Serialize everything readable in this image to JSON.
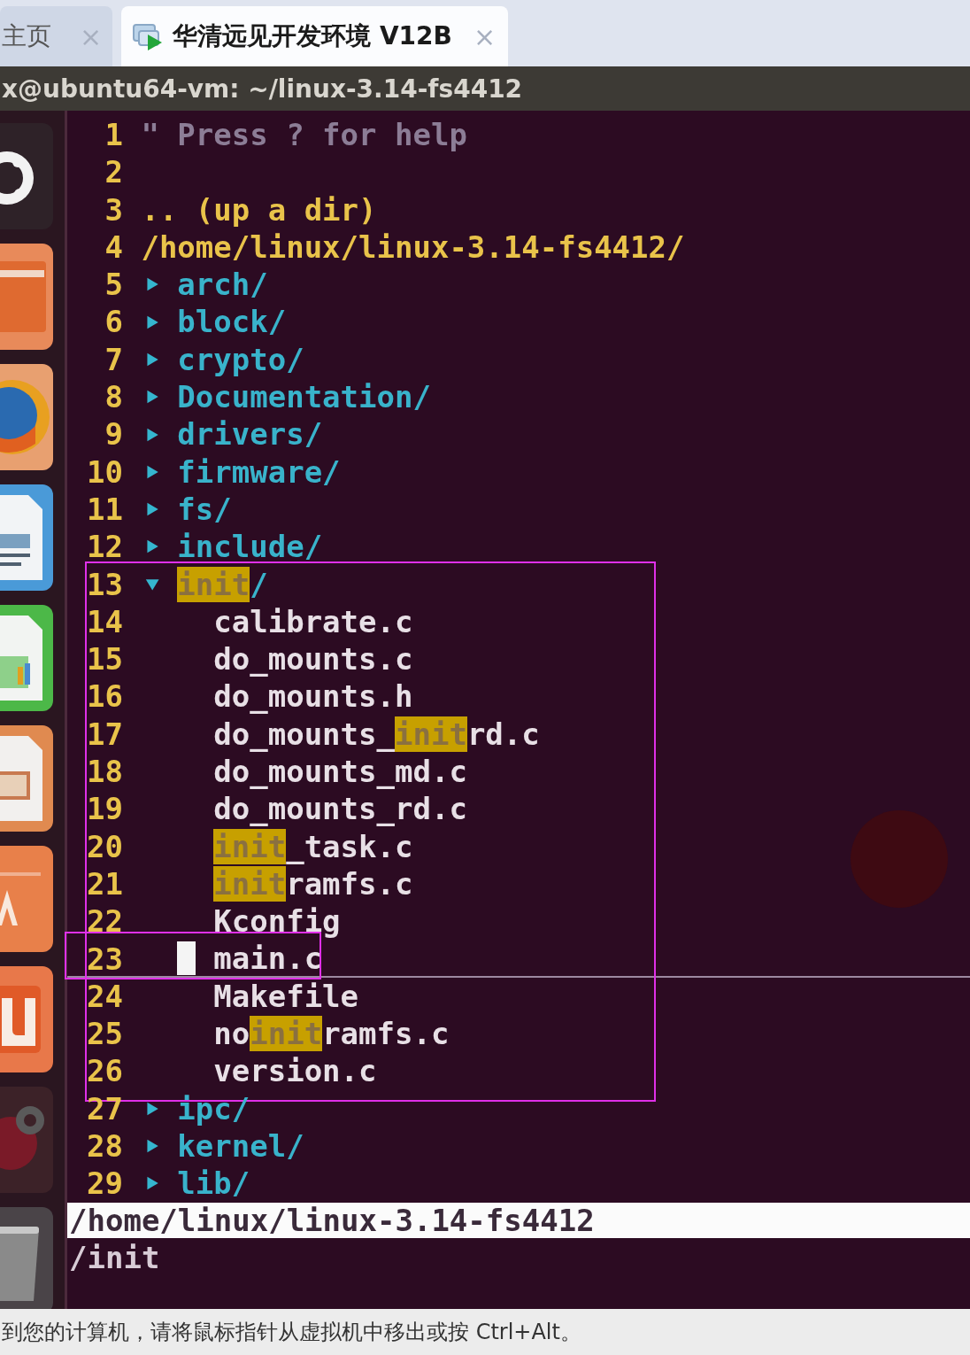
{
  "tabs": [
    {
      "label": "主页",
      "selected": false,
      "close": "×"
    },
    {
      "label": "华清远见开发环境 V12B",
      "selected": true,
      "close": "×"
    }
  ],
  "window": {
    "title": "x@ubuntu64-vm: ~/linux-3.14-fs4412"
  },
  "tree": [
    {
      "number": "1",
      "kind": "comment",
      "text": "\" Press ? for help"
    },
    {
      "number": "2",
      "kind": "blank"
    },
    {
      "number": "3",
      "kind": "updir",
      "text": ".. (up a dir)"
    },
    {
      "number": "4",
      "kind": "root",
      "text": "/home/linux/linux-3.14-fs4412/"
    },
    {
      "number": "5",
      "kind": "dir",
      "expanded": false,
      "boxed": false,
      "text": "arch/"
    },
    {
      "number": "6",
      "kind": "dir",
      "expanded": false,
      "boxed": false,
      "text": "block/"
    },
    {
      "number": "7",
      "kind": "dir",
      "expanded": false,
      "boxed": false,
      "text": "crypto/"
    },
    {
      "number": "8",
      "kind": "dir",
      "expanded": false,
      "boxed": false,
      "text": "Documentation/"
    },
    {
      "number": "9",
      "kind": "dir",
      "expanded": false,
      "boxed": false,
      "text": "drivers/"
    },
    {
      "number": "10",
      "kind": "dir",
      "expanded": false,
      "boxed": false,
      "text": "firmware/"
    },
    {
      "number": "11",
      "kind": "dir",
      "expanded": false,
      "boxed": false,
      "text": "fs/"
    },
    {
      "number": "12",
      "kind": "dir",
      "expanded": false,
      "boxed": false,
      "text": "include/"
    },
    {
      "number": "13",
      "kind": "dir",
      "expanded": true,
      "boxed": true,
      "parts": [
        {
          "text": "init",
          "match": true
        },
        {
          "text": "/",
          "match": false
        }
      ],
      "children": [
        {
          "number": "14",
          "kind": "file",
          "cursor": false,
          "marked": false,
          "text": "calibrate.c"
        },
        {
          "number": "15",
          "kind": "file",
          "cursor": false,
          "marked": false,
          "text": "do_mounts.c"
        },
        {
          "number": "16",
          "kind": "file",
          "cursor": false,
          "marked": false,
          "text": "do_mounts.h"
        },
        {
          "number": "17",
          "kind": "file",
          "cursor": false,
          "marked": false,
          "parts": [
            {
              "text": "do_mounts_",
              "match": false
            },
            {
              "text": "init",
              "match": true
            },
            {
              "text": "rd.c",
              "match": false
            }
          ]
        },
        {
          "number": "18",
          "kind": "file",
          "cursor": false,
          "marked": false,
          "text": "do_mounts_md.c"
        },
        {
          "number": "19",
          "kind": "file",
          "cursor": false,
          "marked": false,
          "text": "do_mounts_rd.c"
        },
        {
          "number": "20",
          "kind": "file",
          "cursor": false,
          "marked": false,
          "parts": [
            {
              "text": "init",
              "match": true
            },
            {
              "text": "_task.c",
              "match": false
            }
          ]
        },
        {
          "number": "21",
          "kind": "file",
          "cursor": false,
          "marked": false,
          "parts": [
            {
              "text": "init",
              "match": true
            },
            {
              "text": "ramfs.c",
              "match": false
            }
          ]
        },
        {
          "number": "22",
          "kind": "file",
          "cursor": false,
          "marked": false,
          "text": "Kconfig"
        },
        {
          "number": "23",
          "kind": "file",
          "cursor": true,
          "marked": true,
          "text": "main.c"
        },
        {
          "number": "24",
          "kind": "file",
          "cursor": false,
          "marked": false,
          "text": "Makefile"
        },
        {
          "number": "25",
          "kind": "file",
          "cursor": false,
          "marked": false,
          "parts": [
            {
              "text": "no",
              "match": false
            },
            {
              "text": "init",
              "match": true
            },
            {
              "text": "ramfs.c",
              "match": false
            }
          ]
        },
        {
          "number": "26",
          "kind": "file",
          "cursor": false,
          "marked": false,
          "text": "version.c"
        }
      ]
    },
    {
      "number": "27",
      "kind": "dir",
      "expanded": false,
      "boxed": false,
      "text": "ipc/"
    },
    {
      "number": "28",
      "kind": "dir",
      "expanded": false,
      "boxed": false,
      "text": "kernel/"
    },
    {
      "number": "29",
      "kind": "dir",
      "expanded": false,
      "boxed": false,
      "text": "lib/"
    }
  ],
  "status_line": {
    "path": "/home/linux/linux-3.14-fs4412",
    "current": "/init"
  },
  "status_bar": {
    "text": "到您的计算机，请将鼠标指针从虚拟机中移出或按 Ctrl+Alt。"
  }
}
